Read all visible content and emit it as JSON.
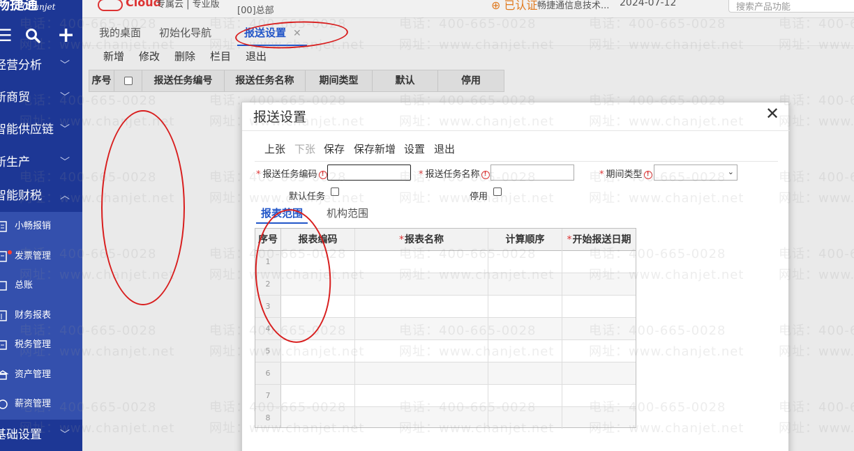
{
  "app": {
    "logo_cn": "畅捷通",
    "logo_en": "Chanjet",
    "cloud_label": "Cloud",
    "edition": "专属云 | 专业版",
    "org": "[00]总部",
    "cert_label": "已认证",
    "company": "畅捷通信息技术...",
    "date": "2024-07-12",
    "search_placeholder": "搜索产品功能"
  },
  "sidebar": {
    "menu": [
      {
        "label": "经营分析"
      },
      {
        "label": "新商贸"
      },
      {
        "label": "智能供应链"
      },
      {
        "label": "新生产"
      },
      {
        "label": "智能财税"
      }
    ],
    "sub": [
      {
        "label": "小畅报销",
        "icon": "receipt-icon"
      },
      {
        "label": "发票管理",
        "icon": "invoice-icon"
      },
      {
        "label": "总账",
        "icon": "ledger-icon"
      },
      {
        "label": "财务报表",
        "icon": "report-icon"
      },
      {
        "label": "税务管理",
        "icon": "tax-icon"
      },
      {
        "label": "资产管理",
        "icon": "asset-icon"
      },
      {
        "label": "薪资管理",
        "icon": "salary-icon"
      }
    ],
    "bottom": {
      "label": "基础设置"
    }
  },
  "tabs": [
    {
      "label": "我的桌面"
    },
    {
      "label": "初始化导航"
    },
    {
      "label": "报送设置",
      "active": true
    }
  ],
  "toolbar": [
    "新增",
    "修改",
    "删除",
    "栏目",
    "退出"
  ],
  "grid": {
    "headers": [
      "序号",
      "",
      "报送任务编号",
      "报送任务名称",
      "期间类型",
      "默认",
      "停用"
    ]
  },
  "modal": {
    "title": "报送设置",
    "buttons": [
      {
        "label": "上张",
        "disabled": false
      },
      {
        "label": "下张",
        "disabled": true
      },
      {
        "label": "保存",
        "disabled": false
      },
      {
        "label": "保存新增",
        "disabled": false
      },
      {
        "label": "设置",
        "disabled": false
      },
      {
        "label": "退出",
        "disabled": false
      }
    ],
    "fields": {
      "code_label": "报送任务编码",
      "name_label": "报送任务名称",
      "period_label": "期间类型",
      "default_label": "默认任务",
      "disabled_label": "停用",
      "code_value": "",
      "name_value": "",
      "period_value": ""
    },
    "subtabs": [
      {
        "label": "报表范围",
        "active": true
      },
      {
        "label": "机构范围",
        "active": false
      }
    ],
    "inner_grid": {
      "headers": [
        {
          "label": "序号",
          "required": false
        },
        {
          "label": "报表编码",
          "required": false
        },
        {
          "label": "报表名称",
          "required": true
        },
        {
          "label": "计算顺序",
          "required": false
        },
        {
          "label": "开始报送日期",
          "required": true
        }
      ],
      "rows": [
        "1",
        "2",
        "3",
        "4",
        "5",
        "6",
        "7",
        "8"
      ]
    }
  },
  "watermark": {
    "phone": "电话：400-665-0028",
    "site": "网址：www.chanjet.net"
  },
  "colors": {
    "sidebar": "#1d3795",
    "sidebar_sub": "#3450ad",
    "accent": "#2256c8",
    "annotation": "#d81e1e"
  }
}
